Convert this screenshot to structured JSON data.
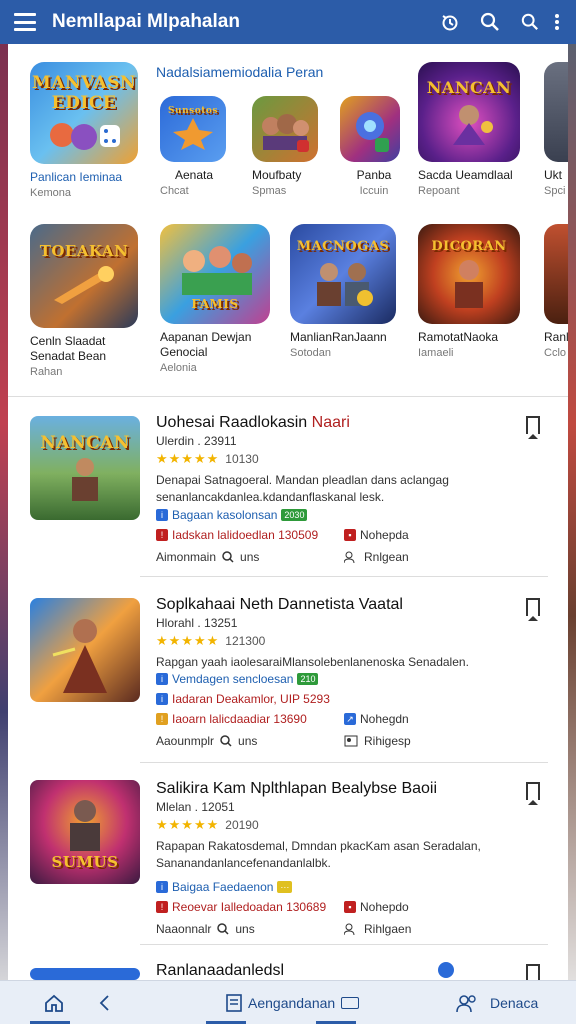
{
  "app_bar": {
    "title": "Nemllapai Mlpahalan"
  },
  "featured": {
    "section_title": "Nadalsiamemiodalia Peran",
    "row1": [
      {
        "name": "Panlican Ieminaa",
        "sub": "Kemona",
        "art": "MANVASN EDICE"
      },
      {
        "name": "Aenata",
        "sub": "Chcat",
        "art": "Sunsotos"
      },
      {
        "name": "Moufbaty",
        "sub": "Spmas",
        "art": ""
      },
      {
        "name": "Panba",
        "sub": "Iccuin",
        "art": ""
      },
      {
        "name": "Sacda Ueamdlaal",
        "sub": "Repoant",
        "art": "NANCAN"
      },
      {
        "name": "Ukt",
        "sub": "Spci",
        "art": ""
      }
    ],
    "row2": [
      {
        "name": "Cenln Slaadat",
        "name2": "Senadat Bean",
        "sub": "Rahan",
        "art": "TOEAKAN"
      },
      {
        "name": "Aapanan Dewjan",
        "name2": "Genocial",
        "sub": "Aelonia",
        "art": "FAMIS"
      },
      {
        "name": "ManlianRanJaann",
        "name2": "",
        "sub": "Sotodan",
        "art": "MACNOGAS"
      },
      {
        "name": "RamotatNaoka",
        "name2": "",
        "sub": "Iamaeli",
        "art": "DICORAN"
      },
      {
        "name": "Ranl",
        "name2": "",
        "sub": "Cclo",
        "art": ""
      }
    ]
  },
  "list": [
    {
      "title": "Uohesai Raadlokasin ",
      "title_em": "Naari",
      "meta": "Ulerdin . 23911",
      "rating": "10130",
      "desc": "Denapai Satnagoeral. Mandan pleadlan dans aclangag senanlancakdanlea.kdandanflaskanal lesk.",
      "tag1": "Bagaan kasolonsan",
      "tag1_pill": "2030",
      "tag2": "Iadskan lalidoedlan 130509",
      "right_tag": "Nohepda",
      "foot_left": "Aimonmain",
      "foot_mid": "uns",
      "foot_right": "Rnlgean",
      "art": "NANCAN"
    },
    {
      "title": "Soplkahaai Neth Dannetista Vaatal",
      "title_em": "",
      "meta": "Hlorahl . 13251",
      "rating": "121300",
      "desc": "Rapgan yaah iaolesaraiMlansolebenlanenoska Senadalen.",
      "tag1": "Vemdagen sencloesan",
      "tag1_pill": "210",
      "tag2": "Iadaran Deakamlor, UIP 5293",
      "tag3": "Iaoarn lalicdaadiar 13690",
      "right_tag": "Nohegdn",
      "foot_left": "Aaounmplr",
      "foot_mid": "uns",
      "foot_right": "Rihigesp",
      "art": ""
    },
    {
      "title": "Salikira Kam Nplthlapan Bealybse Baoii",
      "title_em": "",
      "meta": "Mlelan . 12051",
      "rating": "20190",
      "desc": "Rapapan Rakatosdemal, Dmndan pkacKam asan Seradalan, Sananandanlancefenandanlalbk.",
      "tag1": "Baigaa Faedaenon",
      "tag1_pill": "",
      "tag2": "Reoevar Ialledoadan 130689",
      "right_tag": "Nohepdo",
      "foot_left": "Naaonnalr",
      "foot_mid": "uns",
      "foot_right": "Rihlgaen",
      "art": "SUMUS"
    },
    {
      "title": "Ranlanaadanledsl",
      "title_em": ""
    }
  ],
  "bottom_bar": {
    "home": "",
    "back": "",
    "center": "Aengandanan",
    "right": "Denaca"
  },
  "colors": {
    "primary": "#2c5ca8",
    "star": "#f2b400",
    "link": "#1e5fb0"
  }
}
